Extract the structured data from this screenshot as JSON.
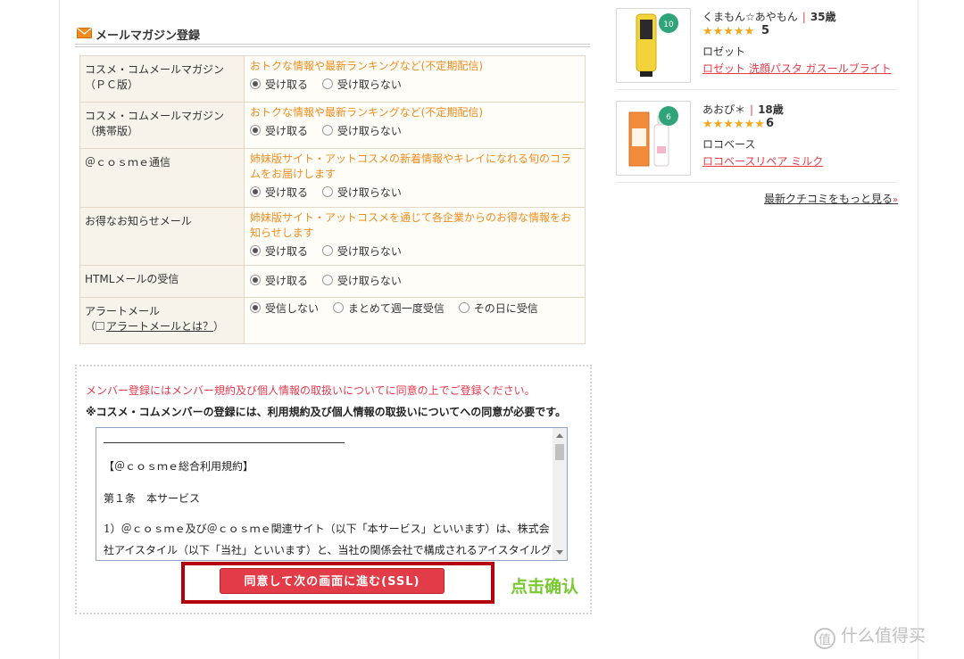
{
  "mail_magazine": {
    "heading": "メールマガジン登録",
    "rows": [
      {
        "label": "コスメ・コムメールマガジン（ＰＣ版）",
        "description": "おトクな情報や最新ランキングなど(不定期配信)",
        "options": [
          "受け取る",
          "受け取らない"
        ],
        "selected": 0
      },
      {
        "label": "コスメ・コムメールマガジン（携帯版）",
        "description": "おトクな情報や最新ランキングなど(不定期配信)",
        "options": [
          "受け取る",
          "受け取らない"
        ],
        "selected": 0
      },
      {
        "label": "＠ｃｏｓｍｅ通信",
        "description": "姉妹版サイト・アットコスメの新着情報やキレイになれる旬のコラムをお届けします",
        "options": [
          "受け取る",
          "受け取らない"
        ],
        "selected": 0
      },
      {
        "label": "お得なお知らせメール",
        "description": "姉妹版サイト・アットコスメを通じて各企業からのお得な情報をお知らせします",
        "options": [
          "受け取る",
          "受け取らない"
        ],
        "selected": 0
      },
      {
        "label": "HTMLメールの受信",
        "description": "",
        "options": [
          "受け取る",
          "受け取らない"
        ],
        "selected": 0
      },
      {
        "label": "アラートメール",
        "label_link": "アラートメールとは？",
        "description": "",
        "options": [
          "受信しない",
          "まとめて週一度受信",
          "その日に受信"
        ],
        "selected": 0
      }
    ]
  },
  "agreement": {
    "notice_red": "メンバー登録にはメンバー規約及び個人情報の取扱いについてに同意の上でご登録ください。",
    "notice": "※コスメ・コムメンバーの登録には、利用規約及び個人情報の取扱いについてへの同意が必要です。",
    "terms_lines": [
      "【＠ｃｏｓｍｅ総合利用規約】",
      "第１条　本サービス",
      "1）＠ｃｏｓｍｅ及び＠ｃｏｓｍｅ関連サイト（以下「本サービス」といいます）は、株式会",
      "社アイスタイル（以下「当社」といいます）と、当社の関係会社で構成されるアイスタイルグ"
    ],
    "button_label": "同意して次の画面に進む(SSL)",
    "annotation": "点击确认"
  },
  "reviews": [
    {
      "user": "くまもん☆あやもん",
      "age": "35歳",
      "stars": "★★★★★",
      "score": "5",
      "brand": "ロゼット",
      "product": "ロゼット 洗顔パスタ ガスールブライト",
      "badge": "10",
      "tube_color": "#f2d43a"
    },
    {
      "user": "あおぴ＊",
      "age": "18歳",
      "stars": "★★★★★★",
      "score": "6",
      "brand": "ロコベース",
      "product": "ロコベースリペア ミルク",
      "badge": "6",
      "tube_color": "#f08c3a"
    }
  ],
  "more_reviews": "最新クチコミをもっと見る",
  "more_arrow": "»",
  "watermark": "什么值得买",
  "watermark_icon": "值"
}
